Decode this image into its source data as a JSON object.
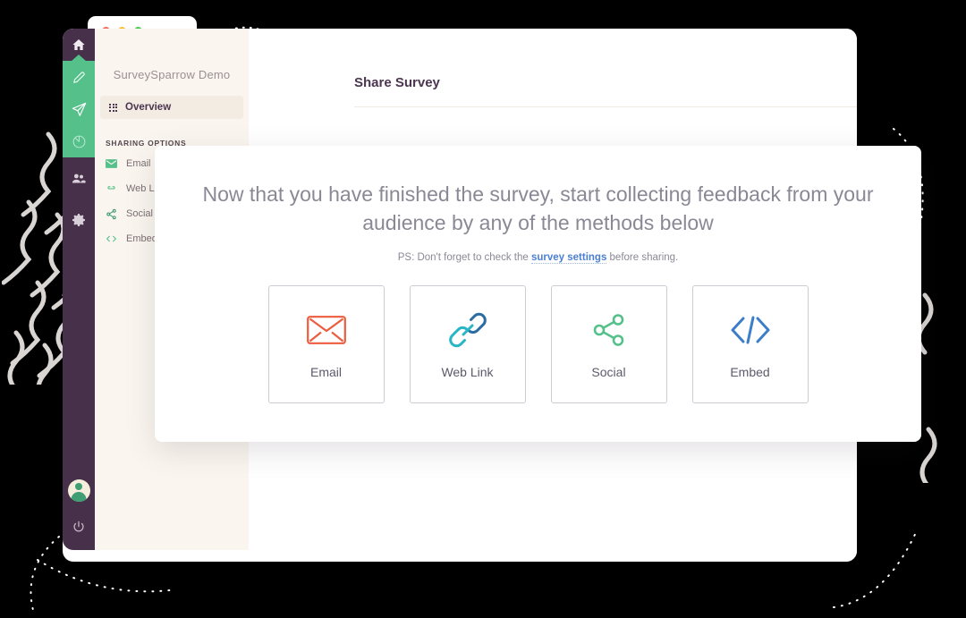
{
  "browser": {
    "traffic_lights": [
      "red",
      "amber",
      "green"
    ]
  },
  "sidebar_rail": {
    "items": [
      {
        "name": "home-icon",
        "label": "Home",
        "active": false
      },
      {
        "name": "edit-icon",
        "label": "Edit",
        "active": true
      },
      {
        "name": "share-icon",
        "label": "Share",
        "active": true
      },
      {
        "name": "results-icon",
        "label": "Results",
        "active": true
      },
      {
        "name": "audience-icon",
        "label": "Audience",
        "active": false
      },
      {
        "name": "settings-icon",
        "label": "Settings",
        "active": false
      }
    ],
    "avatar_label": "User avatar",
    "logout_label": "Log out"
  },
  "sidebar": {
    "workspace_title": "SurveySparrow Demo",
    "overview_label": "Overview",
    "sharing_options_label": "SHARING OPTIONS",
    "sharing_items": [
      {
        "label": "Email",
        "icon": "envelope-icon"
      },
      {
        "label": "Web Link",
        "icon": "link-icon"
      },
      {
        "label": "Social",
        "icon": "share-nodes-icon"
      },
      {
        "label": "Embed",
        "icon": "code-icon"
      }
    ]
  },
  "content": {
    "page_title": "Share Survey"
  },
  "overlay": {
    "heading": "Now that you have finished the survey, start collecting feedback from your audience by any of the methods below",
    "subtext_before": "PS: Don't forget to check the ",
    "link_text": "survey settings",
    "subtext_after": " before sharing.",
    "methods": [
      {
        "label": "Email",
        "icon": "envelope-icon",
        "color": "#ec5c3e"
      },
      {
        "label": "Web Link",
        "icon": "link-icon",
        "color": "#2b6ca3"
      },
      {
        "label": "Social",
        "icon": "share-nodes-icon",
        "color": "#55c08a"
      },
      {
        "label": "Embed",
        "icon": "code-icon",
        "color": "#3d7ec9"
      }
    ]
  },
  "colors": {
    "rail_purple": "#47304a",
    "accent_green": "#55c08a",
    "sidebar_cream": "#faf6ef",
    "heading_grey": "#8b8896",
    "link_blue": "#4a7fd4"
  }
}
